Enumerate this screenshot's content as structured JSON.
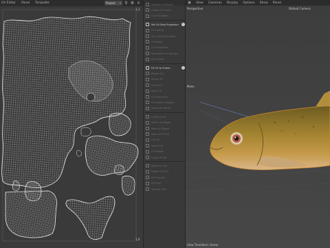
{
  "uv_editor": {
    "menu": [
      "UV Editor",
      "Panel",
      "Tempalte"
    ],
    "mode": "Project",
    "top_right_label": "1,1",
    "bottom_right_label": "1,0"
  },
  "tool_panel": {
    "items": [
      {
        "label": "Unwrap UV Faces",
        "active": false
      },
      {
        "label": "Unfold UV Faces",
        "active": false
      },
      {
        "label": "Cut UV Edges",
        "active": false
      },
      {
        "label": "Set UV Map Projection",
        "active": true
      },
      {
        "label": "UV Unfold",
        "active": false
      },
      {
        "label": "UV Unfold Selection",
        "active": false
      },
      {
        "label": "UV Relax",
        "active": false
      },
      {
        "label": "UV Straighten",
        "active": false
      },
      {
        "label": "Normalize UV Islands",
        "active": false
      },
      {
        "label": "UV Layout",
        "active": false
      },
      {
        "label": "Fit UV to Frame",
        "active": true
      },
      {
        "label": "Rotate UV",
        "active": false
      },
      {
        "label": "Mirror UV",
        "active": false
      },
      {
        "label": "Scale UV",
        "active": false
      },
      {
        "label": "Align UV",
        "active": false
      },
      {
        "label": "UV Distribute",
        "active": false
      },
      {
        "label": "UV Stretch Display",
        "active": false
      },
      {
        "label": "Snap UV Vertex",
        "active": false
      },
      {
        "label": "Unstitch UV",
        "active": false
      },
      {
        "label": "Stitch UV Edges",
        "active": false
      },
      {
        "label": "Sew UV Edges",
        "active": false
      },
      {
        "label": "Move UV Shell",
        "active": false
      },
      {
        "label": "Flip UV",
        "active": false
      },
      {
        "label": "Select UV",
        "active": false
      },
      {
        "label": "UV Border",
        "active": false
      },
      {
        "label": "Copy UV Set",
        "active": false
      },
      {
        "label": "Paste UV Set",
        "active": false
      },
      {
        "label": "Delete UV Set",
        "active": false
      },
      {
        "label": "UV Checker",
        "active": false
      },
      {
        "label": "UV Grid",
        "active": false
      },
      {
        "label": "Texture Size",
        "active": false
      }
    ]
  },
  "viewport": {
    "menu": [
      "View",
      "Cameras",
      "Display",
      "Options",
      "Show",
      "Panel"
    ],
    "view_label": "Perspective",
    "camera_label": "Default Camera",
    "tool_label": "Move",
    "status_label": "View Transform: Scene"
  },
  "colors": {
    "uv_wire": "#e6e6e6",
    "fish_body": "#9a7a28",
    "viewport_bg": "#3c3c3c"
  }
}
